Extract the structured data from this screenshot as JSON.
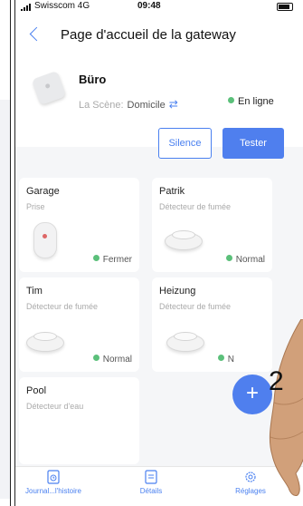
{
  "status_bar": {
    "carrier": "Swisscom",
    "network": "4G",
    "time": "09:48"
  },
  "header": {
    "title": "Page d'accueil de la gateway"
  },
  "device": {
    "name": "Büro",
    "scene_label": "La Scène:",
    "scene_value": "Domicile",
    "status": "En ligne"
  },
  "actions": {
    "silence_label": "Silence",
    "test_label": "Tester"
  },
  "sensors": [
    {
      "name": "Garage",
      "type": "Prise",
      "status": "Fermer"
    },
    {
      "name": "Patrik",
      "type": "Détecteur de fumée",
      "status": "Normal"
    },
    {
      "name": "Tim",
      "type": "Détecteur de fumée",
      "status": "Normal"
    },
    {
      "name": "Heizung",
      "type": "Détecteur de fumée",
      "status": "N"
    },
    {
      "name": "Pool",
      "type": "Détecteur d'eau",
      "status": ""
    }
  ],
  "fab": {
    "label": "+"
  },
  "overlay": {
    "annotation": "2"
  },
  "tabbar": {
    "tabs": [
      {
        "label": "Journal...l'histoire",
        "icon": "history-log-icon"
      },
      {
        "label": "Détails",
        "icon": "details-icon"
      },
      {
        "label": "Réglages",
        "icon": "settings-gear-icon"
      }
    ]
  },
  "colors": {
    "accent": "#4f7fee",
    "online_green": "#5bc07a",
    "background": "#f5f6f8"
  }
}
